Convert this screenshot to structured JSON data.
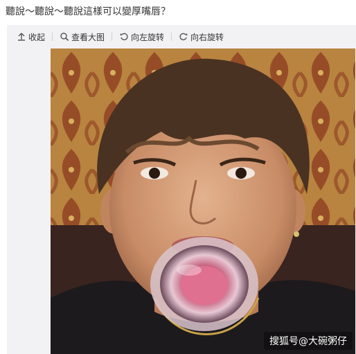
{
  "post": {
    "text": "聽說～聽說～聽說這樣可以變厚嘴唇？"
  },
  "toolbar": {
    "items": [
      {
        "label": "收起",
        "icon": "collapse-up-icon"
      },
      {
        "label": "查看大图",
        "icon": "magnifier-icon"
      },
      {
        "label": "向左旋转",
        "icon": "rotate-left-icon"
      },
      {
        "label": "向右旋转",
        "icon": "rotate-right-icon"
      }
    ]
  },
  "photo": {
    "watermark": "搜狐号@大碗粥仔"
  },
  "colors": {
    "viewer_bg": "#f2f2f5",
    "wallpaper_gold": "#c89a4e",
    "wallpaper_red": "#7a2418"
  }
}
